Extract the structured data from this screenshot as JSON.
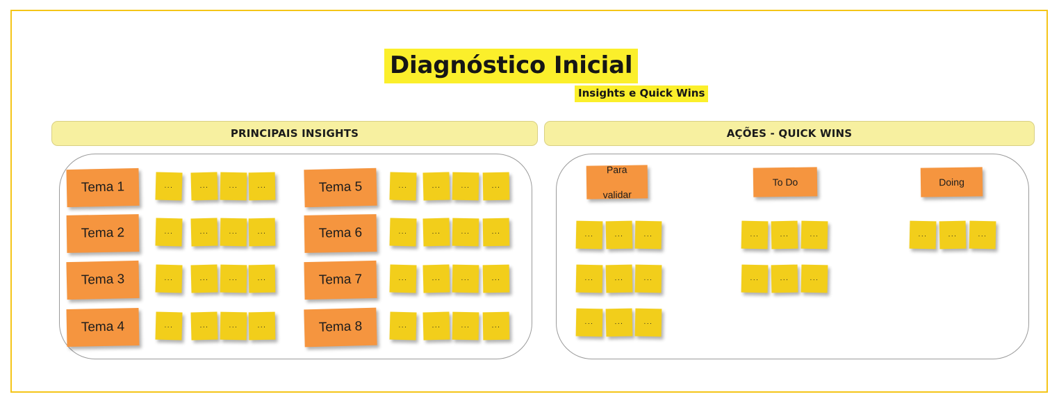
{
  "frame": {
    "border_color": "#F5C518"
  },
  "header": {
    "title": "Diagnóstico Inicial",
    "subtitle": "Insights e Quick Wins",
    "highlight_color": "#FBEF2B"
  },
  "sections": [
    {
      "id": "insights",
      "banner_label": "PRINCIPAIS INSIGHTS",
      "banner_color": "#F7F0A0",
      "columns": [
        {
          "id": "insights-col-1",
          "themes": [
            {
              "label": "Tema 1",
              "notes": [
                "...",
                "...",
                "...",
                "..."
              ]
            },
            {
              "label": "Tema 2",
              "notes": [
                "...",
                "...",
                "...",
                "..."
              ]
            },
            {
              "label": "Tema 3",
              "notes": [
                "...",
                "...",
                "...",
                "..."
              ]
            },
            {
              "label": "Tema 4",
              "notes": [
                "...",
                "...",
                "...",
                "..."
              ]
            }
          ]
        },
        {
          "id": "insights-col-2",
          "themes": [
            {
              "label": "Tema 5",
              "notes": [
                "...",
                "...",
                "...",
                "..."
              ]
            },
            {
              "label": "Tema 6",
              "notes": [
                "...",
                "...",
                "...",
                "..."
              ]
            },
            {
              "label": "Tema 7",
              "notes": [
                "...",
                "...",
                "...",
                "..."
              ]
            },
            {
              "label": "Tema 8",
              "notes": [
                "...",
                "...",
                "...",
                "..."
              ]
            }
          ]
        }
      ]
    },
    {
      "id": "quick-wins",
      "banner_label": "AÇÕES - QUICK WINS",
      "banner_color": "#F7F0A0",
      "lanes": [
        {
          "id": "lane-para-validar",
          "label_line_1": "Para",
          "label_line_2": "validar",
          "label": "Para validar",
          "rows": [
            [
              "...",
              "...",
              "..."
            ],
            [
              "...",
              "...",
              "..."
            ],
            [
              "...",
              "...",
              "..."
            ]
          ]
        },
        {
          "id": "lane-to-do",
          "label_line_1": "To Do",
          "label_line_2": "",
          "label": "To Do",
          "rows": [
            [
              "...",
              "...",
              "..."
            ],
            [
              "...",
              "...",
              "..."
            ]
          ]
        },
        {
          "id": "lane-doing",
          "label_line_1": "Doing",
          "label_line_2": "",
          "label": "Doing",
          "rows": [
            [
              "...",
              "...",
              "..."
            ]
          ]
        }
      ]
    }
  ],
  "colors": {
    "theme_note": "#F5953F",
    "small_note": "#F2CE1B",
    "panel_border": "#9a9a9a"
  }
}
